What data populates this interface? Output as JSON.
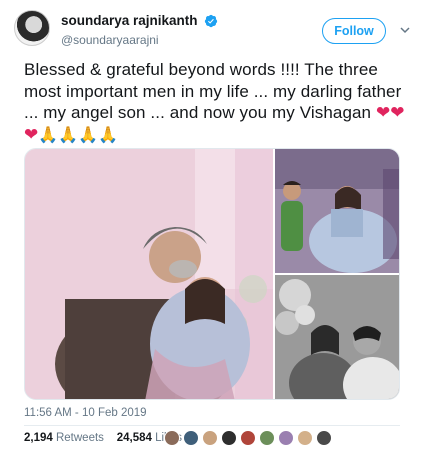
{
  "author": {
    "display_name": "soundarya rajnikanth",
    "handle": "@soundaryaarajni",
    "verified": true
  },
  "follow_button": {
    "label": "Follow"
  },
  "tweet": {
    "text": "Blessed & grateful beyond words !!!! The three most important men in my life ... my darling father ... my angel son ... and now you my Vishagan",
    "emoji": {
      "hearts": "❤❤❤",
      "praying_hands": "🙏🙏🙏🙏"
    }
  },
  "timestamp": "11:56 AM - 10 Feb 2019",
  "stats": {
    "retweets_count": "2,194",
    "retweets_label": "Retweets",
    "likes_count": "24,584",
    "likes_label": "Likes"
  },
  "colors": {
    "accent": "#1da1f2",
    "text_primary": "#14171a",
    "text_secondary": "#657786",
    "heart": "#e0245e"
  },
  "icons": [
    "verified-badge-icon",
    "chevron-down-icon"
  ],
  "media": {
    "photos": [
      "photo-main",
      "photo-top-right",
      "photo-bottom-right"
    ]
  },
  "likers": {
    "avatar_colors": [
      "#8a6b5a",
      "#3f5f7a",
      "#c9a27e",
      "#2e2e2e",
      "#b0453a",
      "#6c8f5a",
      "#9a7fb0",
      "#d3b08a",
      "#4a4a4a"
    ]
  }
}
